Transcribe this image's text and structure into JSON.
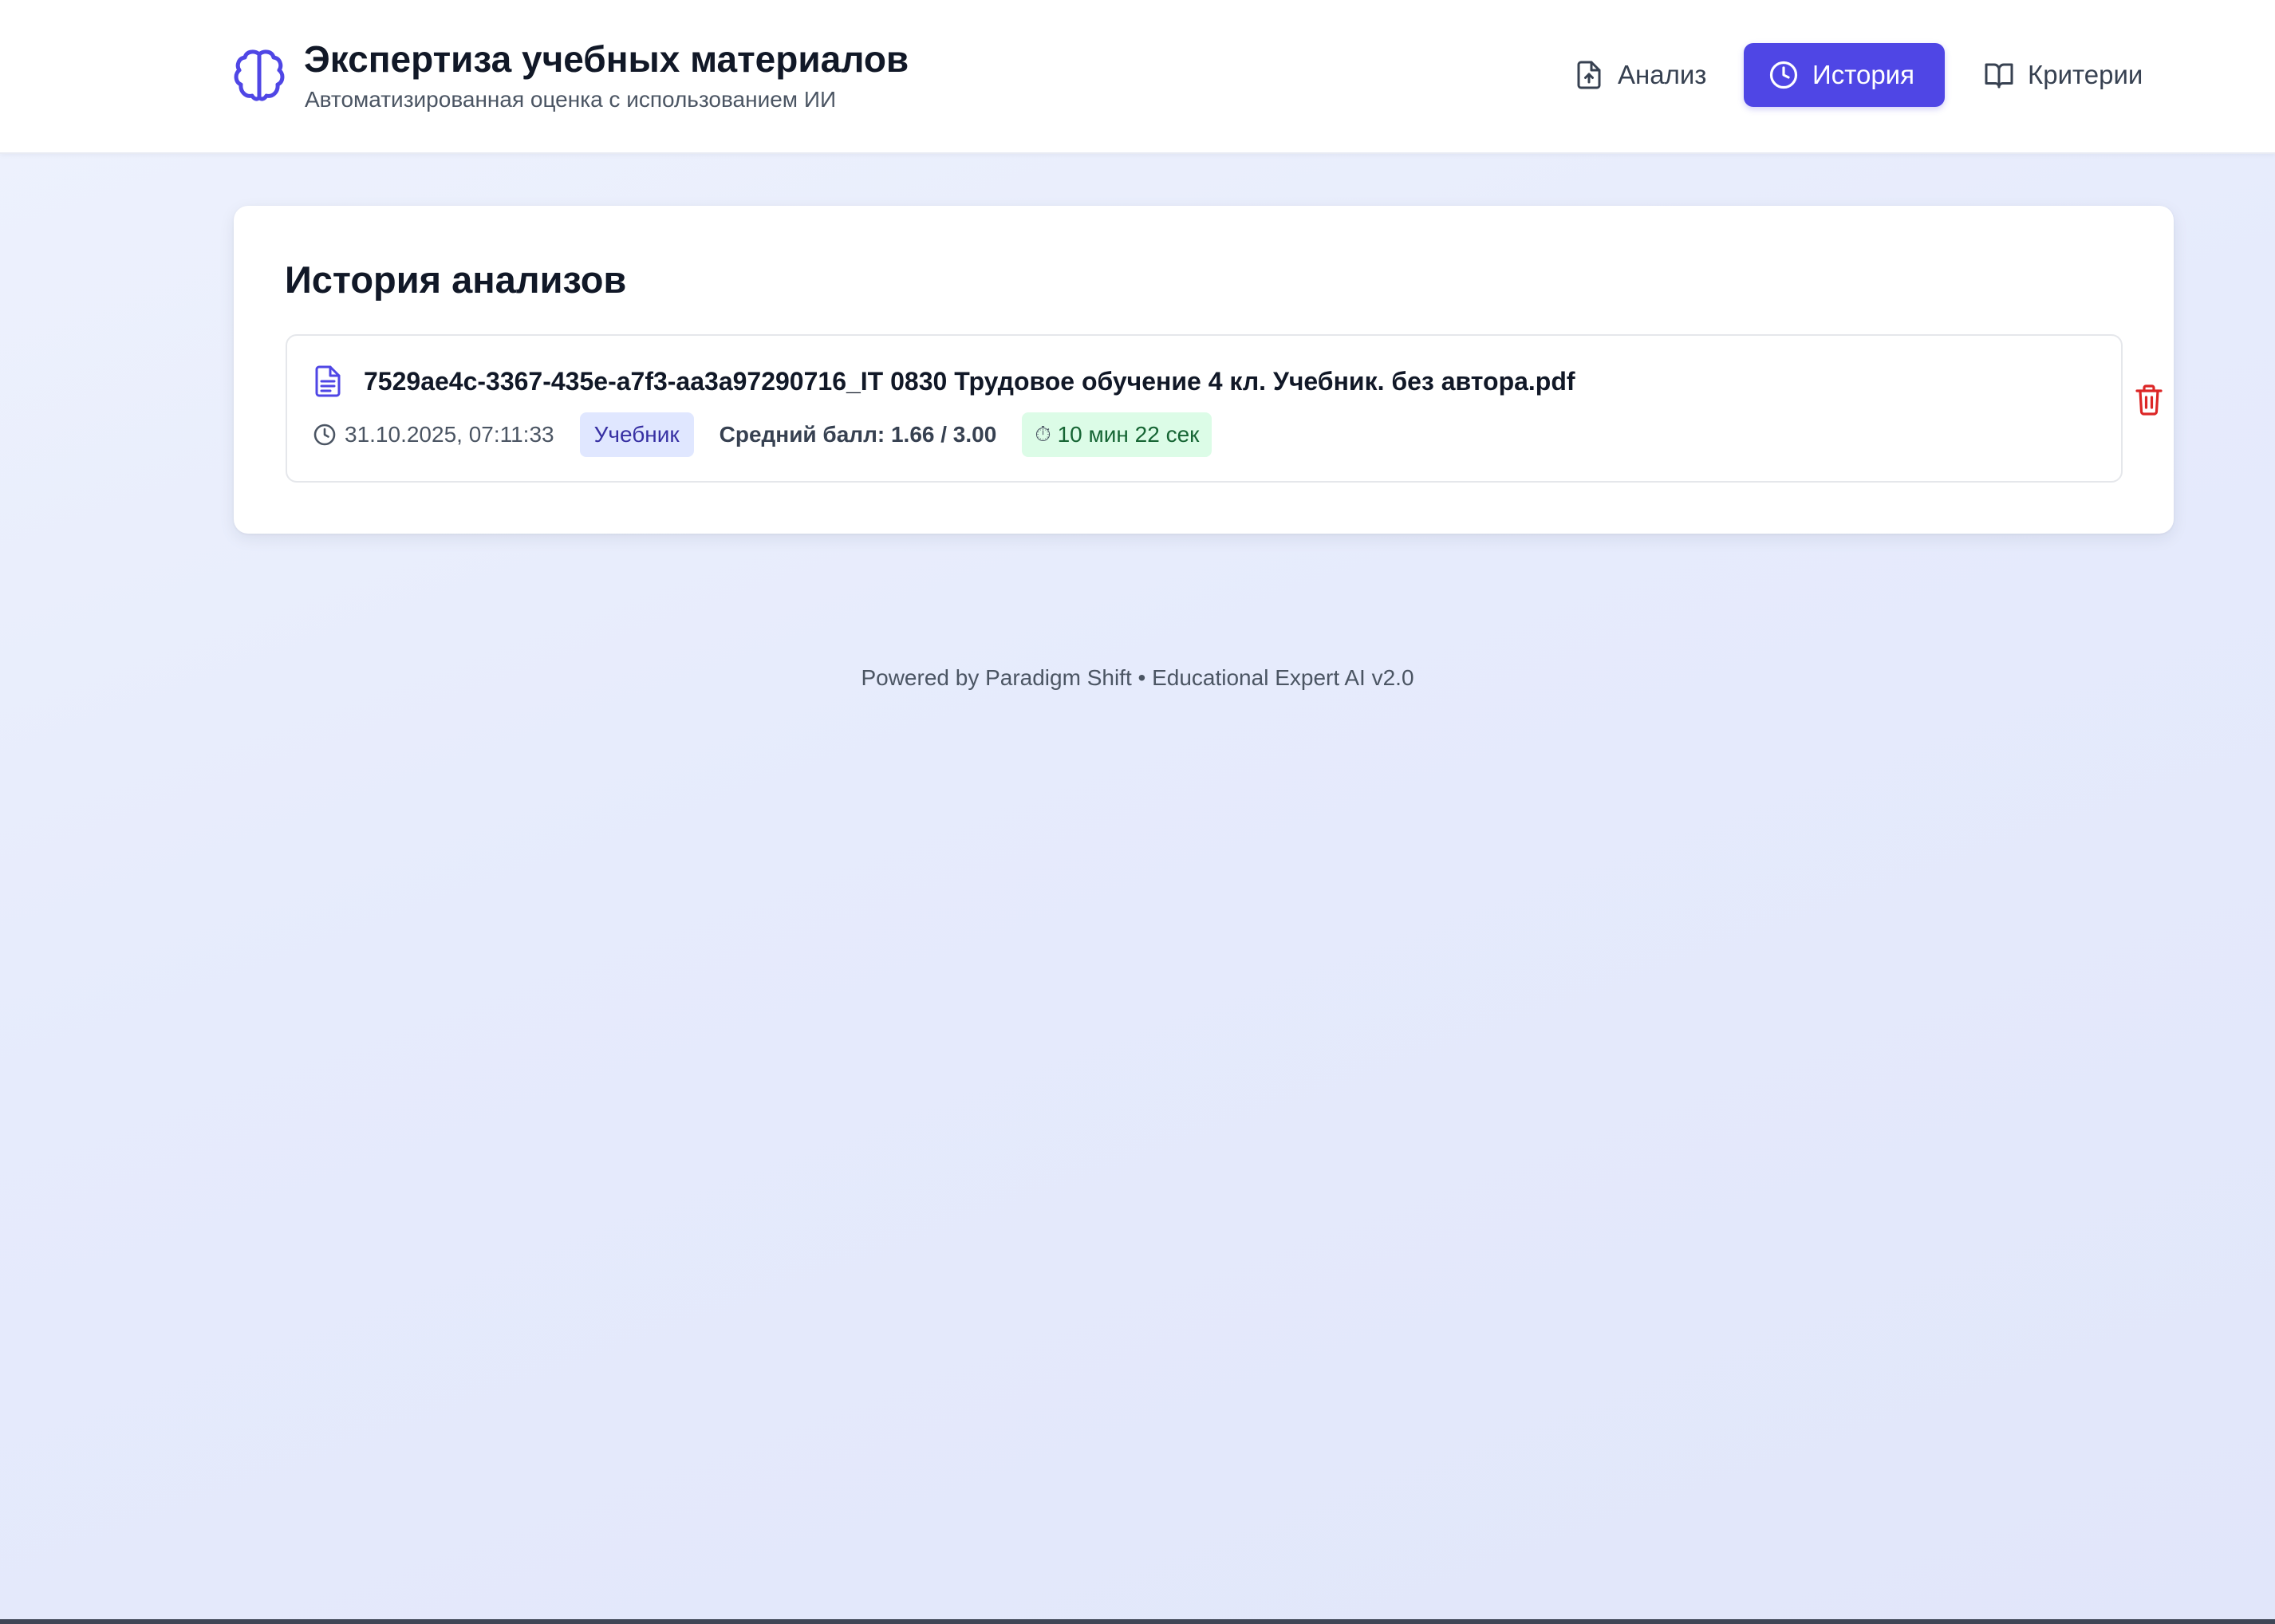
{
  "header": {
    "brand_icon": "brain-icon",
    "title": "Экспертиза учебных материалов",
    "subtitle": "Автоматизированная оценка с использованием ИИ",
    "nav": [
      {
        "label": "Анализ",
        "icon": "file-upload-icon",
        "active": false
      },
      {
        "label": "История",
        "icon": "clock-icon",
        "active": true
      },
      {
        "label": "Критерии",
        "icon": "book-open-icon",
        "active": false
      }
    ]
  },
  "history": {
    "title": "История анализов",
    "items": [
      {
        "file_name": "7529ae4c-3367-435e-a7f3-aa3a97290716_IT 0830 Трудовое обучение 4 кл. Учебник. без автора.pdf",
        "date": "31.10.2025, 07:11:33",
        "type": "Учебник",
        "score": "Средний балл: 1.66 / 3.00",
        "duration_icon": "⏱",
        "duration": "10 мин 22 сек"
      }
    ]
  },
  "footer": {
    "text": "Powered by Paradigm Shift • Educational Expert AI v2.0"
  },
  "colors": {
    "accent": "#4f46e5",
    "badge_type_bg": "#e0e7ff",
    "badge_type_text": "#3730a3",
    "badge_duration_bg": "#dcfce7",
    "badge_duration_text": "#166534",
    "delete": "#dc2626"
  }
}
